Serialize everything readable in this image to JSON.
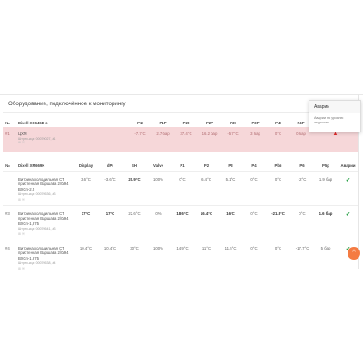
{
  "panel": {
    "title": "Оборудование, подключённое к мониторингу"
  },
  "popover": {
    "title": "Аварии",
    "body": "Аварии по уровню жидкости"
  },
  "table1": {
    "headers": [
      "№",
      "Dixell XC645D s",
      "P1t",
      "P1P",
      "P2t",
      "P2P",
      "P3t",
      "P3P",
      "P4t",
      "P4P",
      ""
    ],
    "row": {
      "num": "#1",
      "name": "ЦХМ",
      "sub": "Штрих-код: 00070027, #1",
      "icons": "⊞ 🗎",
      "values": [
        "-7.7°C",
        "2.7 бар",
        "37.4°C",
        "16.2 бар",
        "-5.7°C",
        "3 бар",
        "0°C",
        "0 бар"
      ]
    }
  },
  "table2": {
    "headers": [
      "№",
      "Dixell XM669K",
      "Display",
      "dPr",
      "SH",
      "Valve",
      "P1",
      "P2",
      "P3",
      "P4",
      "Pb5",
      "P6",
      "P5p",
      "Аварии"
    ],
    "rows": [
      {
        "num": "",
        "name": "Витрина холодильная СТ пристенная Варшава 2/0/94 ВХСп-2,5",
        "sub": "Штрих-код: 00070536, #3",
        "icons": "⊞ 🗎",
        "values": [
          "3.6°C",
          "-3.6°C",
          "20.9°C",
          "100%",
          "0°C",
          "6.4°C",
          "5.1°C",
          "0°C",
          "0°C",
          "-2°C",
          "1.9 бар"
        ]
      },
      {
        "num": "#3",
        "name": "Витрина холодильная СТ пристенная Варшава 2/0/94 ВХСп-1,875",
        "sub": "Штрих-код: 00070541, #3",
        "icons": "⊞ 🗎",
        "values": [
          "17°C",
          "17°C",
          "22.6°C",
          "0%",
          "18.6°C",
          "16.4°C",
          "16°C",
          "0°C",
          "-21.8°C",
          "0°C",
          "1.6 бар"
        ]
      },
      {
        "num": "#4",
        "name": "Витрина холодильная СТ пристенная Варшава 2/0/94 ВХСп-1,875",
        "sub": "Штрих-код: 00070538, #4",
        "icons": "⊞ 🗎",
        "values": [
          "10.4°C",
          "10.4°C",
          "30°C",
          "100%",
          "14.9°C",
          "11°C",
          "11.5°C",
          "0°C",
          "0°C",
          "-17.7°C",
          "5 бар"
        ]
      }
    ]
  },
  "fab": {
    "label": "^"
  },
  "colors": {
    "alarm_row": "#f6d7d9",
    "accent": "#f47b42",
    "ok": "#2ca24a",
    "warn": "#e02b2b"
  },
  "icons": {
    "ok": "check-icon",
    "alarm": "warning-triangle-icon",
    "scroll_top": "chevron-up-icon"
  }
}
